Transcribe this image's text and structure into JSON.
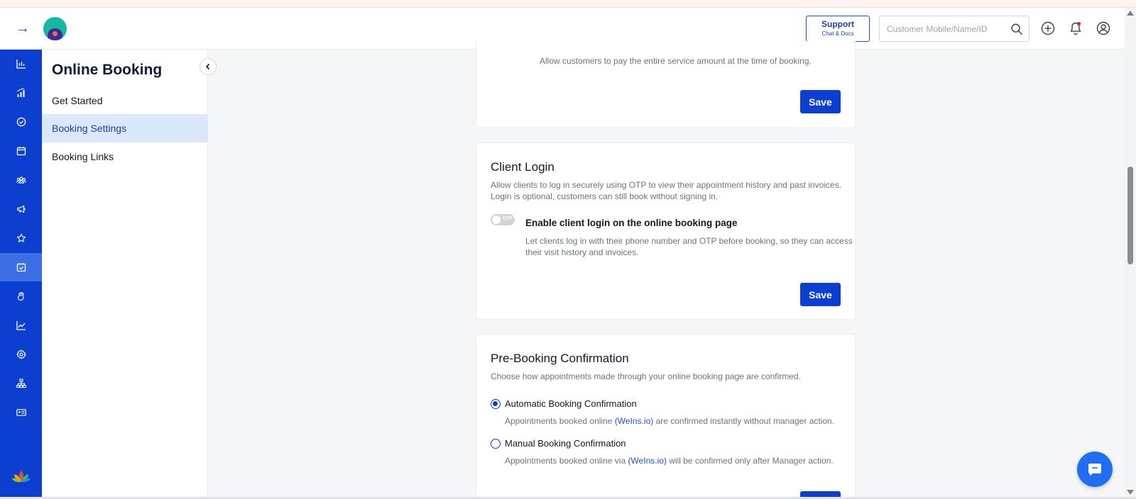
{
  "header": {
    "support": {
      "title": "Support",
      "subtitle": "Chat & Docs"
    },
    "search": {
      "placeholder": "Customer Mobile/Name/ID"
    }
  },
  "sidebar_rail": {
    "icons": [
      "bar-chart-icon",
      "signal-bars-icon",
      "check-circle-icon",
      "calendar-icon",
      "users-group-icon",
      "megaphone-icon",
      "star-icon",
      "calendar-check-icon",
      "hand-icon",
      "trend-chart-icon",
      "gear-icon",
      "hierarchy-icon",
      "id-card-icon"
    ],
    "active_index": 7
  },
  "subnav": {
    "title": "Online Booking",
    "items": [
      {
        "label": "Get Started"
      },
      {
        "label": "Booking Settings"
      },
      {
        "label": "Booking Links"
      }
    ],
    "active": "Booking Settings"
  },
  "main": {
    "payment_card": {
      "desc": "Allow customers to pay the entire service amount at the time of booking.",
      "save_label": "Save"
    },
    "client_login": {
      "title": "Client Login",
      "desc_line1": "Allow clients to log in securely using OTP to view their appointment history and past invoices.",
      "desc_line2": "Login is optional, customers can still book without signing in.",
      "toggle_state": "OFF",
      "toggle_label": "Enable client login on the online booking page",
      "toggle_desc_line1": "Let clients log in with their phone number and OTP before booking, so they can access",
      "toggle_desc_line2": "their visit history and invoices.",
      "save_label": "Save"
    },
    "pre_booking": {
      "title": "Pre-Booking Confirmation",
      "desc": "Choose how appointments made through your online booking page are confirmed.",
      "options": [
        {
          "label": "Automatic Booking Confirmation",
          "desc_before": "Appointments booked online ",
          "link": "(WeIns.io)",
          "desc_after": " are confirmed instantly without manager action.",
          "selected": true
        },
        {
          "label": "Manual Booking Confirmation",
          "desc_before": "Appointments booked online via ",
          "link": "(WeIns.io)",
          "desc_after": " will be confirmed only after Manager action.",
          "selected": false
        }
      ]
    }
  },
  "colors": {
    "rail": "#0c3fd0",
    "rail_active": "#3d6ee6",
    "primary_button": "#0c3fd0",
    "subnav_active_bg": "#dbe7fb",
    "chat_button": "#1e6ff2"
  }
}
